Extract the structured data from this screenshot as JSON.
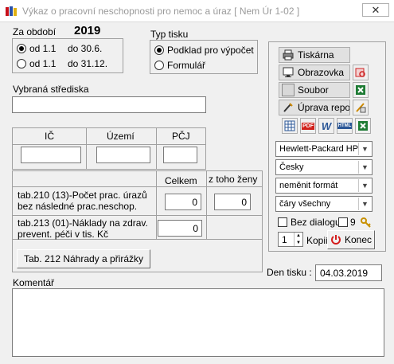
{
  "window": {
    "title": "Výkaz o pracovní neschopnosti pro nemoc a úraz  [ Nem Úr 1-02 ]",
    "close_glyph": "✕"
  },
  "period": {
    "label": "Za období",
    "year": "2019",
    "options": [
      {
        "from": "od 1.1",
        "to": "do 30.6.",
        "selected": true
      },
      {
        "from": "od 1.1",
        "to": "do 31.12.",
        "selected": false
      }
    ]
  },
  "print_type": {
    "label": "Typ tisku",
    "options": [
      {
        "label": "Podklad pro výpočet",
        "selected": true
      },
      {
        "label": "Formulář",
        "selected": false
      }
    ]
  },
  "centers": {
    "label": "Vybraná střediska",
    "value": ""
  },
  "ids": {
    "ic_label": "IČ",
    "uzemi_label": "Území",
    "pcj_label": "PČJ",
    "ic_value": "",
    "uzemi_value": "",
    "pcj_value": ""
  },
  "table": {
    "col_total": "Celkem",
    "col_women": "z toho ženy",
    "row1_label": "tab.210 (13)-Počet prac. úrazů bez následné prac.neschop.",
    "row1_total": "0",
    "row1_women": "0",
    "row2_label": "tab.213 (01)-Náklady na zdrav. prevent. péči v tis. Kč",
    "row2_total": "0",
    "tab212_button": "Tab. 212 Náhrady a přirážky"
  },
  "output": {
    "printer_button": "Tiskárna",
    "screen_button": "Obrazovka",
    "file_button": "Soubor",
    "edit_report_button": "Úprava repor",
    "printer_select": "Hewlett-Packard HP",
    "language_select": "Česky",
    "format_select": "neměnit formát",
    "lines_select": "čáry všechny",
    "no_dialog_label": "Bez dialogu",
    "no_dialog_value": "9",
    "copies_value": "1",
    "copies_label": "Kopií",
    "end_button": "Konec",
    "export_icons": [
      "grid-export-icon",
      "pdf-icon",
      "word-icon",
      "html-icon",
      "excel-icon"
    ],
    "pdf_text": "PDF",
    "word_text": "W",
    "html_text": "HTML"
  },
  "date": {
    "label": "Den tisku :",
    "value": "04.03.2019"
  },
  "comment": {
    "label": "Komentář",
    "value": ""
  },
  "colors": {
    "excel_green": "#1e7b34",
    "pdf_red": "#d0201a",
    "word_blue": "#2b5797",
    "power_red": "#d41b1b"
  }
}
